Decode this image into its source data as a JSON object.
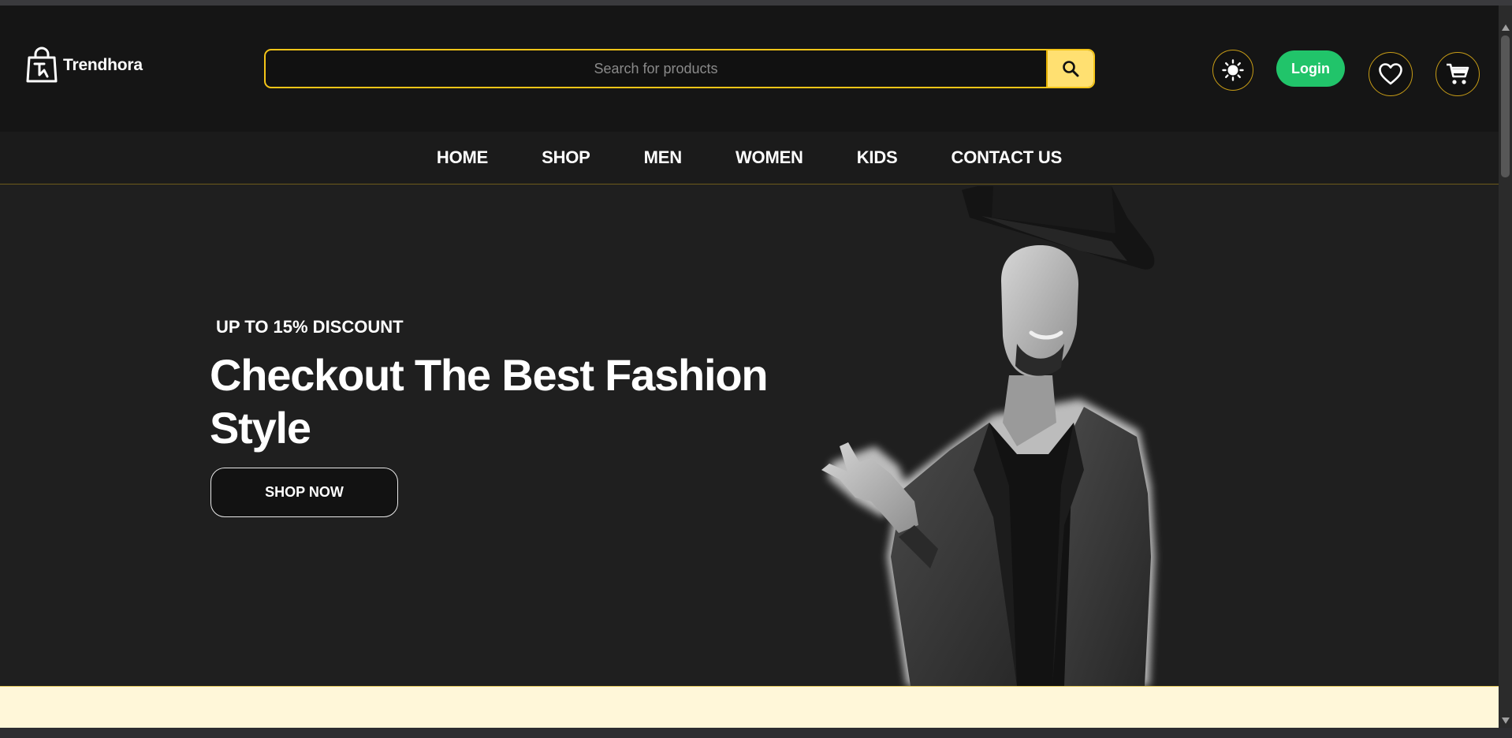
{
  "brand": {
    "name": "Trendhora",
    "logo_icon": "shopping-bag-logo-icon"
  },
  "search": {
    "placeholder": "Search for products",
    "value": "",
    "button_icon": "search-icon"
  },
  "header_actions": {
    "theme_icon": "sun-icon",
    "login_label": "Login",
    "wishlist_icon": "heart-icon",
    "cart_icon": "cart-icon"
  },
  "nav": {
    "items": [
      {
        "label": "HOME"
      },
      {
        "label": "SHOP"
      },
      {
        "label": "MEN"
      },
      {
        "label": "WOMEN"
      },
      {
        "label": "KIDS"
      },
      {
        "label": "CONTACT US"
      }
    ]
  },
  "hero": {
    "eyebrow": "UP TO 15% DISCOUNT",
    "headline": "Checkout The Best Fashion Style",
    "cta_label": "SHOP NOW",
    "image": "model-in-fedora-and-blazer"
  },
  "colors": {
    "accent": "#f5c518",
    "search_button": "#ffe071",
    "login": "#21c46a",
    "header_bg": "#151515",
    "hero_bg": "#1f1f1f",
    "band_bg": "#fff7d9"
  }
}
